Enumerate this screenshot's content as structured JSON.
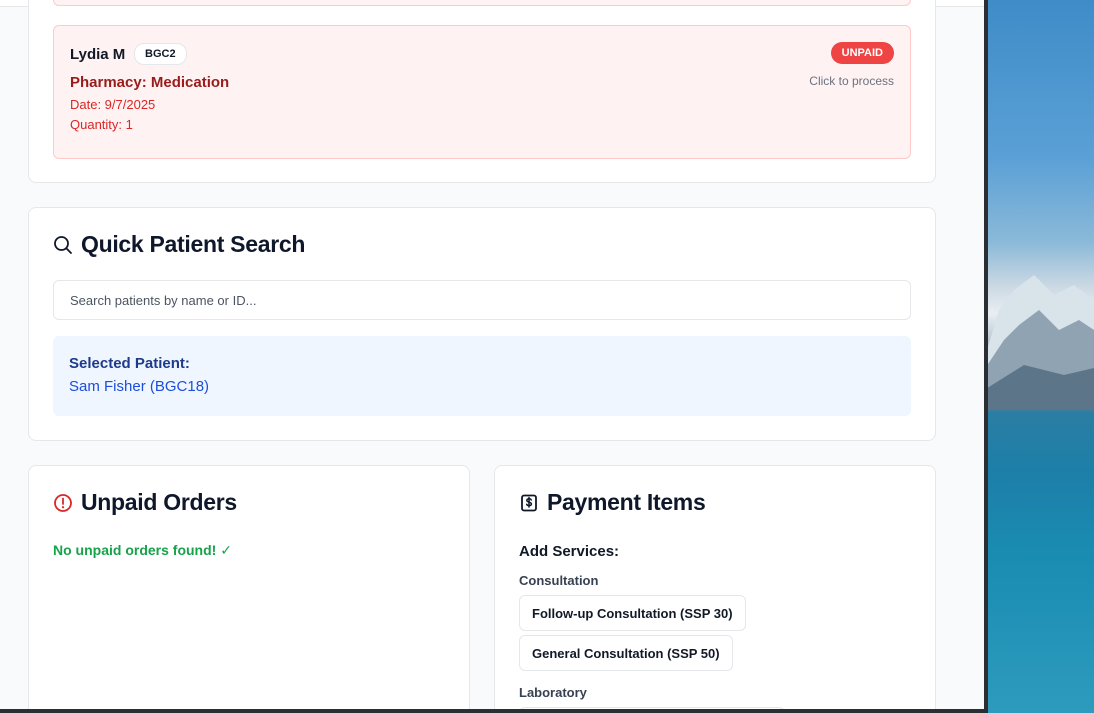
{
  "previous_order": {},
  "order": {
    "patient_name": "Lydia M",
    "patient_id": "BGC2",
    "title": "Pharmacy: Medication",
    "date": "Date: 9/7/2025",
    "quantity": "Quantity: 1",
    "status": "UNPAID",
    "hint": "Click to process"
  },
  "search": {
    "title": "Quick Patient Search",
    "placeholder": "Search patients by name or ID...",
    "value": "",
    "selected_label": "Selected Patient:",
    "selected_value": "Sam Fisher (BGC18)"
  },
  "unpaid_orders": {
    "title": "Unpaid Orders",
    "empty_message": "No unpaid orders found! ✓"
  },
  "payment_items": {
    "title": "Payment Items",
    "add_services_label": "Add Services:",
    "sections": [
      {
        "label": "Consultation",
        "services": [
          "Follow-up Consultation (SSP 30)",
          "General Consultation (SSP 50)"
        ]
      },
      {
        "label": "Laboratory",
        "services": [
          ""
        ]
      }
    ]
  },
  "colors": {
    "unpaid_badge": "#ef4444",
    "order_bg": "#fef2f2",
    "success": "#16a34a",
    "selected_bg": "#eff6ff",
    "selected_text": "#1d4ed8"
  },
  "icons": {
    "search": "search-icon",
    "unpaid": "alert-circle-icon",
    "payment": "receipt-dollar-icon"
  }
}
